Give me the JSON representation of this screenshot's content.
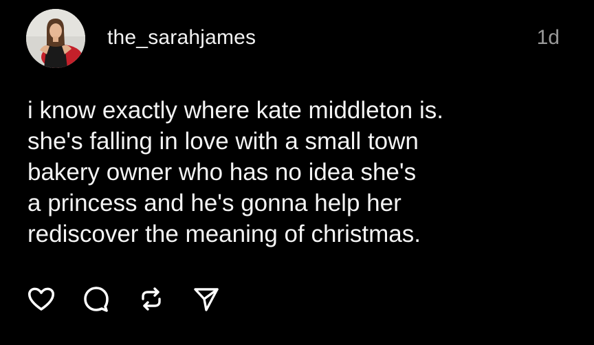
{
  "post": {
    "username": "the_sarahjames",
    "timestamp": "1d",
    "text_lines": [
      "i know exactly where kate middleton is.",
      "she's falling in love with a small town",
      "bakery owner who has no idea she's",
      "a princess and he's gonna help her",
      "rediscover the meaning of christmas."
    ]
  },
  "actions": [
    {
      "name": "like-button",
      "icon": "heart-icon"
    },
    {
      "name": "reply-button",
      "icon": "comment-icon"
    },
    {
      "name": "repost-button",
      "icon": "repost-icon"
    },
    {
      "name": "share-button",
      "icon": "send-icon"
    }
  ],
  "colors": {
    "background": "#000000",
    "text": "#f4f4f4",
    "muted": "#9a9a9a"
  }
}
